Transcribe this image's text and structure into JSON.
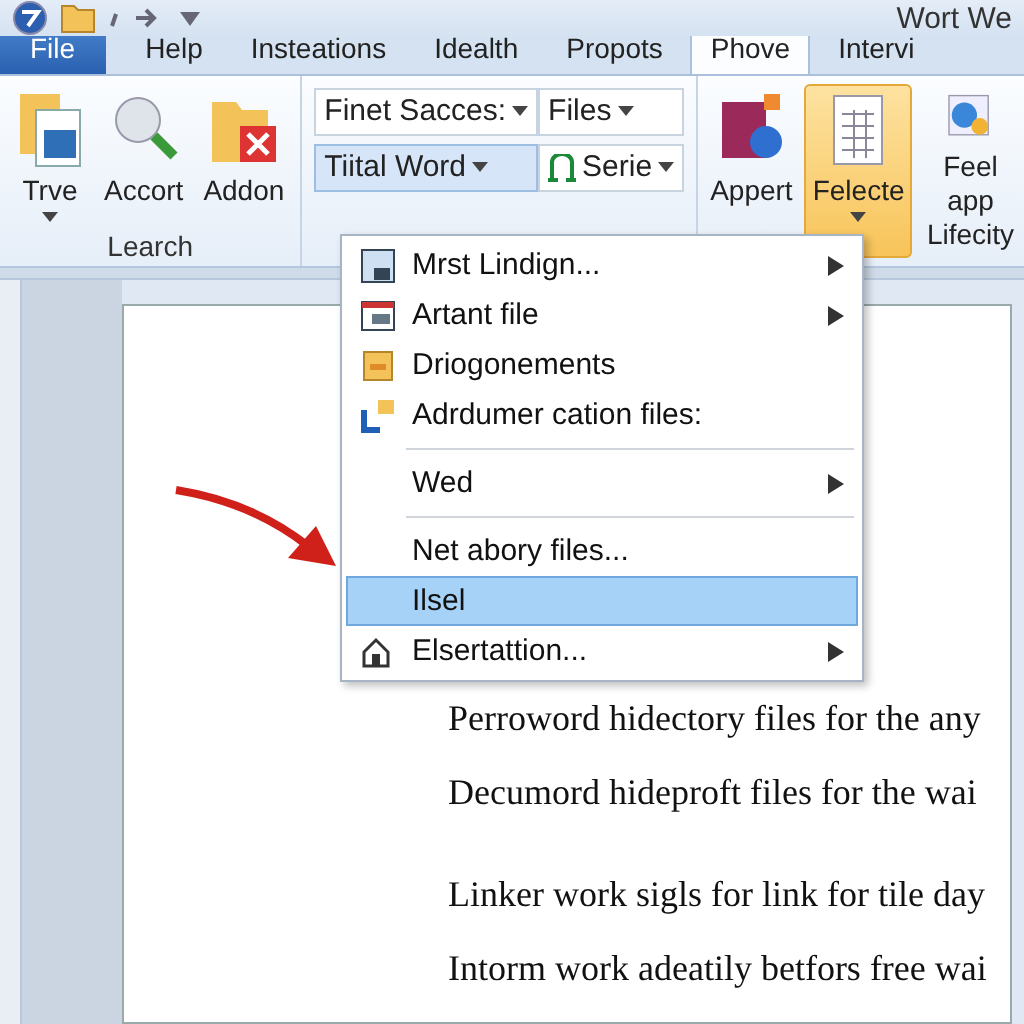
{
  "window": {
    "title": "Wort We"
  },
  "tabs": [
    {
      "label": "File",
      "kind": "file",
      "selected": false
    },
    {
      "label": "Help",
      "kind": "tab",
      "selected": false
    },
    {
      "label": "Insteations",
      "kind": "tab",
      "selected": false
    },
    {
      "label": "Idealth",
      "kind": "tab",
      "selected": false
    },
    {
      "label": "Propots",
      "kind": "tab",
      "selected": false
    },
    {
      "label": "Phove",
      "kind": "tab",
      "selected": true
    },
    {
      "label": "Intervi",
      "kind": "tab",
      "selected": false
    }
  ],
  "ribbon": {
    "group_1": {
      "label": "Learch",
      "buttons": [
        {
          "label": "Trve",
          "dropdown": true,
          "selected": false
        },
        {
          "label": "Accort",
          "dropdown": false,
          "selected": false
        },
        {
          "label": "Addon",
          "dropdown": false,
          "selected": false
        }
      ]
    },
    "combos": [
      {
        "label": "Finet Sacces:",
        "selected": false
      },
      {
        "label": "Files",
        "selected": false
      },
      {
        "label": "Tiital Word",
        "selected": true
      },
      {
        "label": "Serie",
        "selected": false
      }
    ],
    "buttons": [
      {
        "label": "Appert",
        "dropdown": false,
        "selected": false
      },
      {
        "label": "Felecte",
        "dropdown": true,
        "selected": true
      },
      {
        "label": "Feel app Lifecity",
        "dropdown": false,
        "selected": false
      }
    ]
  },
  "menu": [
    {
      "kind": "item",
      "label": "Mrst Lindign...",
      "submenu": true,
      "selected": false
    },
    {
      "kind": "item",
      "label": "Artant file",
      "submenu": true,
      "selected": false
    },
    {
      "kind": "item",
      "label": "Driogonements",
      "submenu": false,
      "selected": false
    },
    {
      "kind": "item",
      "label": "Adrdumer cation files:",
      "submenu": false,
      "selected": false
    },
    {
      "kind": "separator"
    },
    {
      "kind": "item",
      "label": "Wed",
      "submenu": true,
      "selected": false
    },
    {
      "kind": "separator"
    },
    {
      "kind": "item",
      "label": "Net abory files...",
      "submenu": false,
      "selected": false
    },
    {
      "kind": "item",
      "label": "Ilsel",
      "submenu": false,
      "selected": true
    },
    {
      "kind": "item",
      "label": "Elsertattion...",
      "submenu": true,
      "selected": false
    }
  ],
  "document": {
    "paragraphs": [
      "Perroword hidectory files for the any",
      "Decumord hideproft files for the wai",
      "Linker work sigls for link for tile day",
      "Intorm work adeatily betfors free wai"
    ]
  }
}
